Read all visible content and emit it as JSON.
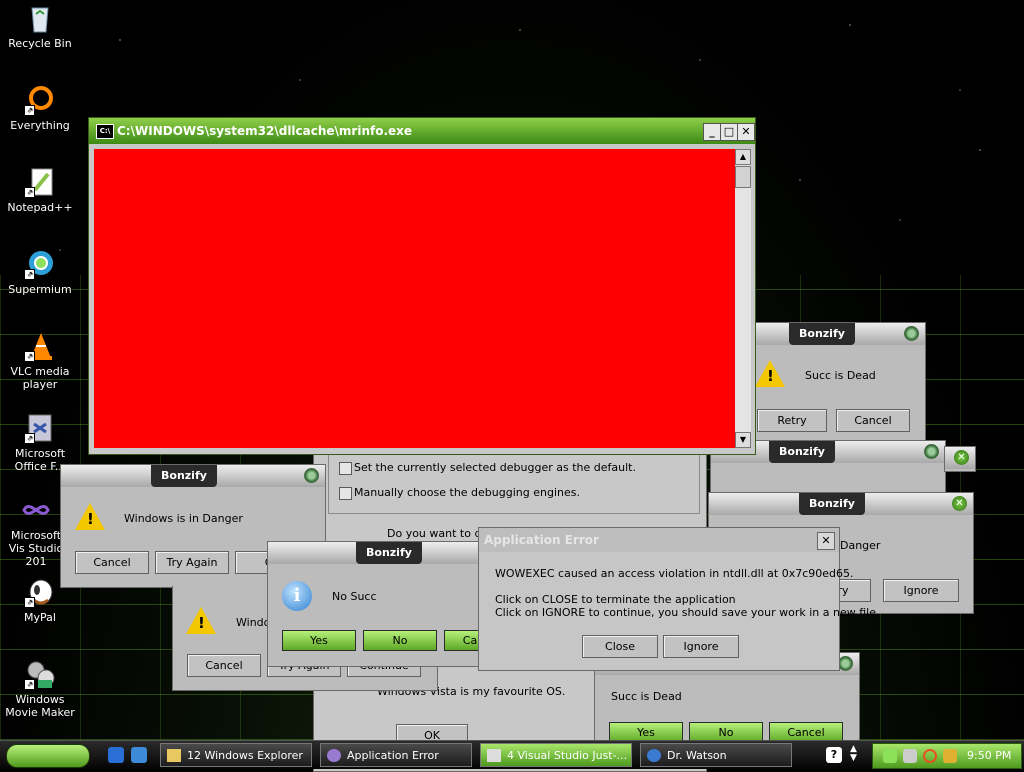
{
  "desktop": {
    "icons": [
      {
        "label": "Recycle Bin",
        "icon": "recycle-bin-icon"
      },
      {
        "label": "Everything",
        "icon": "everything-icon"
      },
      {
        "label": "Notepad++",
        "icon": "notepad-plus-plus-icon"
      },
      {
        "label": "Supermium",
        "icon": "supermium-icon"
      },
      {
        "label": "VLC media player",
        "icon": "vlc-icon"
      },
      {
        "label": "Microsoft Office F...",
        "icon": "office-icon"
      },
      {
        "label": "Microsoft Vis Studio 201",
        "icon": "visual-studio-icon"
      },
      {
        "label": "MyPal",
        "icon": "mypal-icon"
      },
      {
        "label": "Windows Movie Maker",
        "icon": "movie-maker-icon"
      }
    ]
  },
  "console": {
    "title": "C:\\WINDOWS\\system32\\dllcache\\mrinfo.exe",
    "icon_text": "C:\\",
    "min": "_",
    "max": "□",
    "close": "✕"
  },
  "debugger": {
    "opt1": "Set the currently selected debugger as the default.",
    "opt2": "Manually choose the debugging engines.",
    "question": "Do you want to deb",
    "os_text": "Windows Vista is my favourite OS.",
    "ok": "OK"
  },
  "dialogs": {
    "succ_top": {
      "title": "Bonzify",
      "message": "Succ is Dead",
      "b1": "Retry",
      "b2": "Cancel"
    },
    "mid_right": {
      "title": "Bonzify"
    },
    "danger_right": {
      "title": "Bonzify",
      "message": "Danger",
      "b1": "cry",
      "b2": "Ignore"
    },
    "danger_left": {
      "title": "Bonzify",
      "message": "Windows is in Danger",
      "b1": "Cancel",
      "b2": "Try Again",
      "b3": "Co"
    },
    "windo_left": {
      "message": "Windo",
      "b1": "Cancel",
      "b2": "Try Again",
      "b3": "Continue"
    },
    "no_succ": {
      "title": "Bonzify",
      "message": "No Succ",
      "b1": "Yes",
      "b2": "No",
      "b3": "Ca"
    },
    "succ_bottom": {
      "message": "Succ is Dead",
      "b1": "Yes",
      "b2": "No",
      "b3": "Cancel"
    }
  },
  "app_error": {
    "title": "Application Error",
    "line1": "WOWEXEC caused an access violation in ntdll.dll at 0x7c90ed65.",
    "line2": "Click on CLOSE to terminate the application",
    "line3": "Click on IGNORE to continue, you should save your work in a new file.",
    "close": "Close",
    "ignore": "Ignore"
  },
  "taskbar": {
    "tasks": [
      {
        "label": "12 Windows Explorer"
      },
      {
        "label": "Application Error"
      },
      {
        "label": "4 Visual Studio Just-..."
      },
      {
        "label": "Dr. Watson"
      }
    ],
    "clock": "9:50 PM"
  },
  "colors": {
    "accent_green": "#5ea826",
    "console_red": "#ff0000"
  }
}
